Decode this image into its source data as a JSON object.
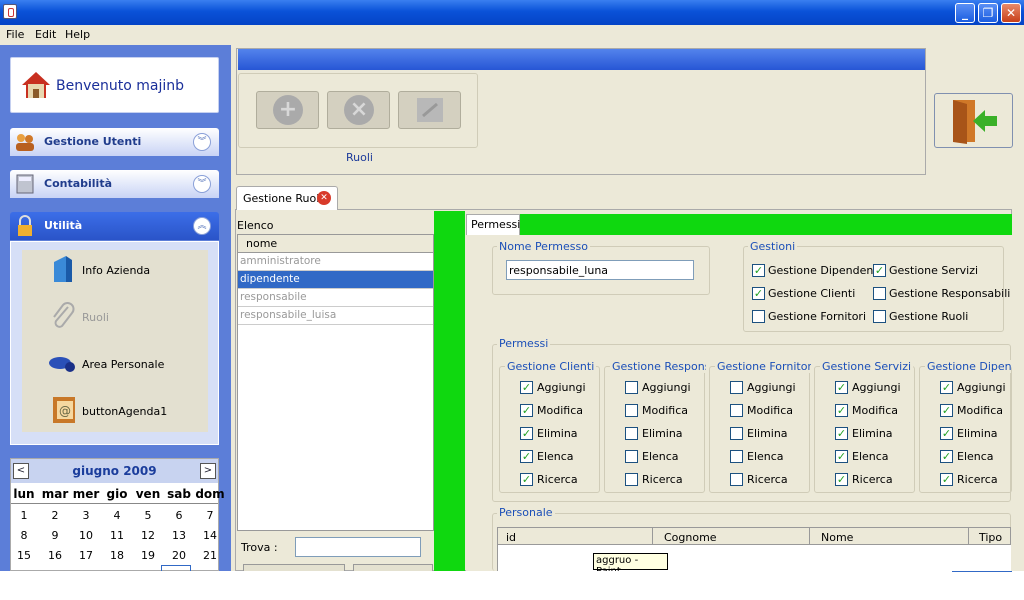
{
  "window": {
    "min": "_",
    "max": "❐",
    "close": "✕"
  },
  "menubar": {
    "file": "File",
    "edit": "Edit",
    "help": "Help"
  },
  "sidebar": {
    "welcome": "Benvenuto majinb",
    "sections": [
      {
        "label": "Gestione Utenti"
      },
      {
        "label": "Contabilità"
      },
      {
        "label": "Utilità"
      }
    ],
    "items": [
      {
        "label": "Info Azienda"
      },
      {
        "label": "Ruoli"
      },
      {
        "label": "Area Personale"
      },
      {
        "label": "buttonAgenda1"
      }
    ]
  },
  "calendar": {
    "title": "giugno 2009",
    "prev": "<",
    "next": ">",
    "dow": [
      "lun",
      "mar",
      "mer",
      "gio",
      "ven",
      "sab",
      "dom"
    ],
    "weeks": [
      [
        "1",
        "2",
        "3",
        "4",
        "5",
        "6",
        "7"
      ],
      [
        "8",
        "9",
        "10",
        "11",
        "12",
        "13",
        "14"
      ],
      [
        "15",
        "16",
        "17",
        "18",
        "19",
        "20",
        "21"
      ]
    ]
  },
  "toolbar": {
    "group_label": "Ruoli",
    "add": "+",
    "remove": "×"
  },
  "tab": {
    "title": "Gestione Ruoli"
  },
  "elenco": {
    "label": "Elenco",
    "header": "nome",
    "rows": [
      "amministratore",
      "dipendente",
      "responsabile",
      "responsabile_luisa"
    ],
    "trova": "Trova :"
  },
  "permessi": {
    "tab": "Permessi",
    "nome_label": "Nome Permesso",
    "nome_value": "responsabile_luna",
    "gestioni_label": "Gestioni",
    "gestioni": [
      {
        "label": "Gestione Dipendenti",
        "checked": true
      },
      {
        "label": "Gestione Servizi",
        "checked": true
      },
      {
        "label": "Gestione Clienti",
        "checked": true
      },
      {
        "label": "Gestione Responsabili",
        "checked": false
      },
      {
        "label": "Gestione Fornitori",
        "checked": false
      },
      {
        "label": "Gestione Ruoli",
        "checked": false
      }
    ],
    "permessi_label": "Permessi",
    "groups": [
      {
        "title": "Gestione Clienti",
        "checks": [
          true,
          true,
          true,
          true,
          true
        ]
      },
      {
        "title": "Gestione Responsab",
        "checks": [
          false,
          false,
          false,
          false,
          false
        ]
      },
      {
        "title": "Gestione Fornitori",
        "checks": [
          false,
          false,
          false,
          false,
          false
        ]
      },
      {
        "title": "Gestione Servizi",
        "checks": [
          true,
          true,
          true,
          true,
          true
        ]
      },
      {
        "title": "Gestione Dipende",
        "checks": [
          true,
          true,
          true,
          true,
          true
        ]
      }
    ],
    "actions": [
      "Aggiungi",
      "Modifica",
      "Elimina",
      "Elenca",
      "Ricerca"
    ],
    "personale_label": "Personale",
    "table_headers": [
      "id",
      "Cognome",
      "Nome",
      "Tipo"
    ]
  },
  "tooltip": "aggruo - Paint",
  "check_mark": "✓"
}
